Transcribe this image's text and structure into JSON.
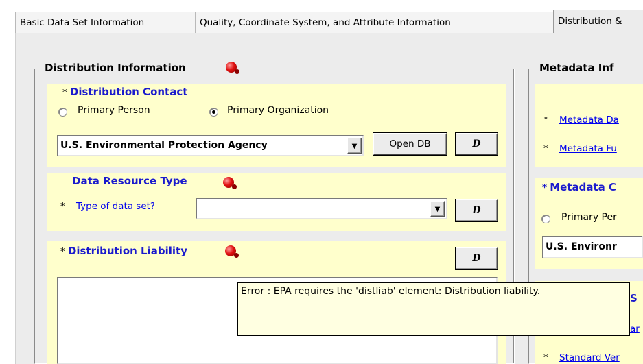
{
  "tabs": [
    {
      "label": "Basic Data Set Information"
    },
    {
      "label": "Quality, Coordinate System, and Attribute Information"
    },
    {
      "label": "Distribution &"
    }
  ],
  "distribution": {
    "legend": "Distribution Information",
    "contact": {
      "star": "*",
      "title": "Distribution Contact",
      "radio_person": "Primary Person",
      "radio_org": "Primary Organization",
      "selected": "Primary Organization",
      "combo_value": "U.S. Environmental Protection Agency",
      "open_db": "Open DB",
      "d_label": "D"
    },
    "resource": {
      "title": "Data Resource Type",
      "star": "*",
      "link": "Type of data set?",
      "combo_value": "",
      "d_label": "D"
    },
    "liability": {
      "star": "*",
      "title": "Distribution Liability",
      "d_label": "D",
      "text_value": ""
    }
  },
  "metadata": {
    "legend": "Metadata Inf",
    "link1": "Metadata Da",
    "link2": "Metadata Fu",
    "contact_title": "Metadata C",
    "radio_person": "Primary Per",
    "combo_value": "U.S. Environr",
    "partial_s": "S",
    "partial_ar": "ar",
    "link3": "Standard Ver",
    "star": "*"
  },
  "tooltip": {
    "text": "Error : EPA requires the 'distliab' element: Distribution liability."
  },
  "colors": {
    "panel": "#ececec",
    "section_bg": "#ffffcc",
    "title_blue": "#1a1acd",
    "link_blue": "#0000ee",
    "tooltip_bg": "#ffffe1"
  }
}
